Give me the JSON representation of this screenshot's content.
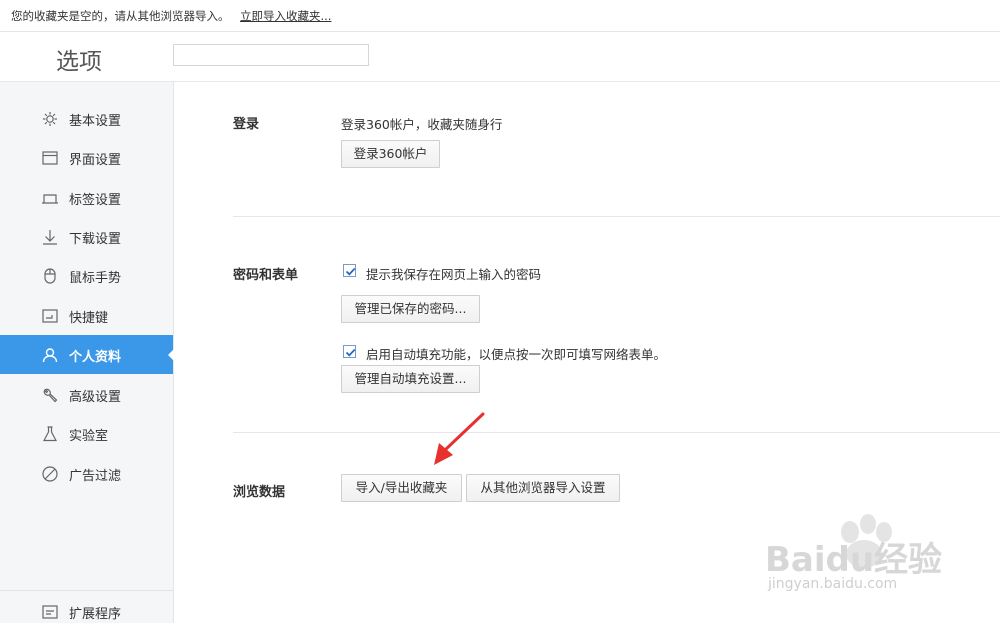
{
  "bookmark_bar": {
    "message": "您的收藏夹是空的，请从其他浏览器导入。",
    "import_link": "立即导入收藏夹..."
  },
  "header": {
    "title": "选项",
    "search_placeholder": ""
  },
  "sidebar": {
    "items": [
      {
        "label": "基本设置",
        "icon": "gear-icon"
      },
      {
        "label": "界面设置",
        "icon": "window-icon"
      },
      {
        "label": "标签设置",
        "icon": "tab-icon"
      },
      {
        "label": "下载设置",
        "icon": "download-icon"
      },
      {
        "label": "鼠标手势",
        "icon": "mouse-icon"
      },
      {
        "label": "快捷键",
        "icon": "keyboard-icon"
      },
      {
        "label": "个人资料",
        "icon": "user-icon",
        "active": true
      },
      {
        "label": "高级设置",
        "icon": "wrench-icon"
      },
      {
        "label": "实验室",
        "icon": "flask-icon"
      },
      {
        "label": "广告过滤",
        "icon": "block-icon"
      }
    ],
    "footer_item": {
      "label": "扩展程序",
      "icon": "extension-icon"
    }
  },
  "login": {
    "label": "登录",
    "description": "登录360帐户，收藏夹随身行",
    "button": "登录360帐户"
  },
  "passwords": {
    "label": "密码和表单",
    "save_password_checkbox": "提示我保存在网页上输入的密码",
    "save_password_checked": true,
    "manage_passwords_button": "管理已保存的密码...",
    "autofill_checkbox": "启用自动填充功能，以便点按一次即可填写网络表单。",
    "autofill_checked": true,
    "manage_autofill_button": "管理自动填充设置..."
  },
  "browsing_data": {
    "label": "浏览数据",
    "import_export_button": "导入/导出收藏夹",
    "import_from_other_button": "从其他浏览器导入设置"
  },
  "watermark": {
    "brand": "Baidu经验",
    "url": "jingyan.baidu.com"
  },
  "colors": {
    "accent": "#3b98e8",
    "sidebar_bg": "#f5f6f7",
    "arrow": "#e8312f"
  }
}
